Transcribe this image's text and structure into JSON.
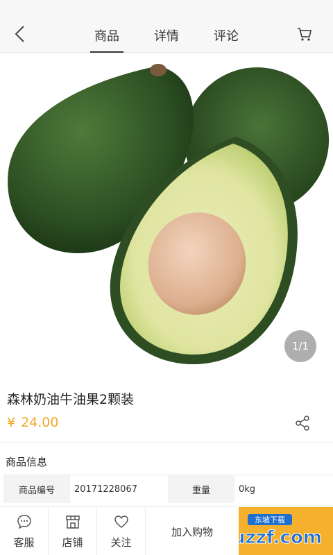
{
  "header": {
    "tabs": [
      {
        "label": "商品",
        "active": true
      },
      {
        "label": "详情",
        "active": false
      },
      {
        "label": "评论",
        "active": false
      }
    ]
  },
  "gallery": {
    "counter": "1/1"
  },
  "product": {
    "title": "森林奶油牛油果2颗装",
    "currency": "¥",
    "price": "24.00",
    "price_color": "#f5a623"
  },
  "info": {
    "title": "商品信息",
    "specs": [
      {
        "label": "商品编号",
        "value": "20171228067"
      },
      {
        "label": "重量",
        "value": "0kg"
      }
    ]
  },
  "bottom_bar": {
    "items": [
      {
        "label": "客服",
        "icon": "chat-icon"
      },
      {
        "label": "店铺",
        "icon": "store-icon"
      },
      {
        "label": "关注",
        "icon": "heart-icon"
      }
    ],
    "add_to_cart": "加入购物",
    "buy_color": "#f5b02e"
  },
  "watermark": {
    "text": "uzzf.com",
    "sub": "东坡下载"
  }
}
